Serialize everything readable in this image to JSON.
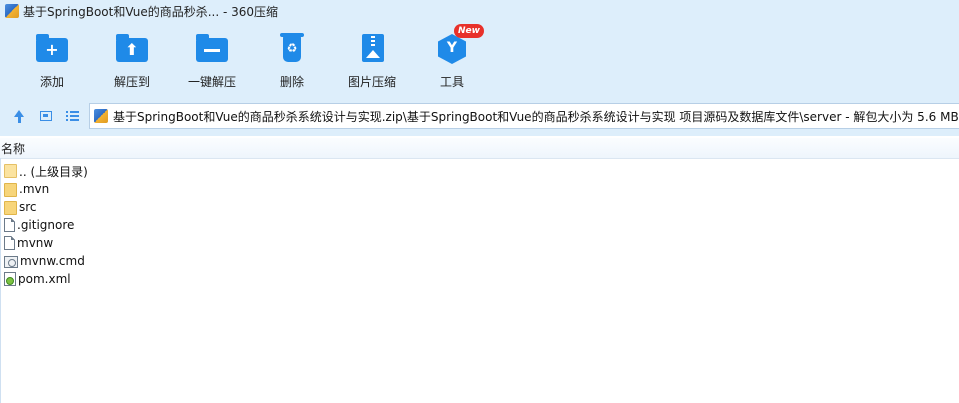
{
  "window": {
    "title": "基于SpringBoot和Vue的商品秒杀... - 360压缩"
  },
  "toolbar": {
    "add": "添加",
    "extract_to": "解压到",
    "one_click_extract": "一键解压",
    "delete": "删除",
    "image_compress": "图片压缩",
    "tools": "工具",
    "tools_badge": "New"
  },
  "address": {
    "path": "基于SpringBoot和Vue的商品秒杀系统设计与实现.zip\\基于SpringBoot和Vue的商品秒杀系统设计与实现 项目源码及数据库文件\\server - 解包大小为 5.6 MB"
  },
  "columns": {
    "name": "名称"
  },
  "files": [
    {
      "name": ".. (上级目录)",
      "icon": "folder-open-icon"
    },
    {
      "name": ".mvn",
      "icon": "folder-icon"
    },
    {
      "name": "src",
      "icon": "folder-icon"
    },
    {
      "name": ".gitignore",
      "icon": "file-icon"
    },
    {
      "name": "mvnw",
      "icon": "file-icon"
    },
    {
      "name": "mvnw.cmd",
      "icon": "cmd-file-icon"
    },
    {
      "name": "pom.xml",
      "icon": "xml-file-icon"
    }
  ],
  "colors": {
    "accent": "#1f8ae8",
    "top_bg": "#ddeefb",
    "badge": "#e8312a"
  }
}
